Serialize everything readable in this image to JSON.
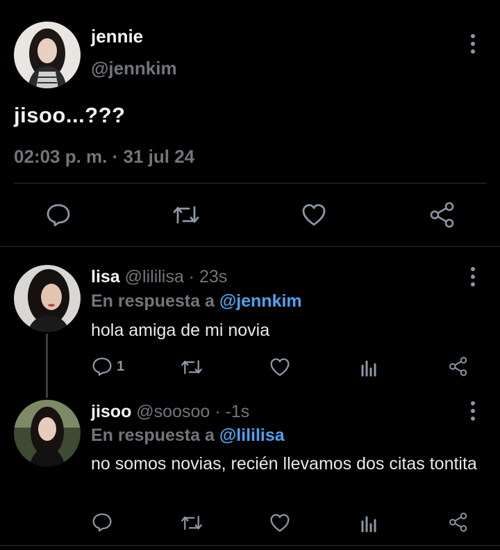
{
  "main_tweet": {
    "name": "jennie",
    "handle": "@jennkim",
    "text": "jisoo...???",
    "timestamp": "02:03 p. m. · 31 jul 24",
    "actions": [
      "reply-icon",
      "retweet-icon",
      "like-icon",
      "share-icon"
    ]
  },
  "replies": [
    {
      "name": "lisa",
      "handle_time": "@lililisa · 23s",
      "reply_prefix": "En respuesta a ",
      "reply_to": "@jennkim",
      "text": "hola amiga de mi novia",
      "reply_count": "1"
    },
    {
      "name": "jisoo",
      "handle_time": "@soosoo · -1s",
      "reply_prefix": "En respuesta a ",
      "reply_to": "@lililisa",
      "text": "no somos novias, recién llevamos dos citas tontita",
      "reply_count": ""
    }
  ],
  "colors": {
    "background": "#000000",
    "link": "#4ea3ef",
    "muted": "#71767b",
    "divider": "#2f3336"
  }
}
